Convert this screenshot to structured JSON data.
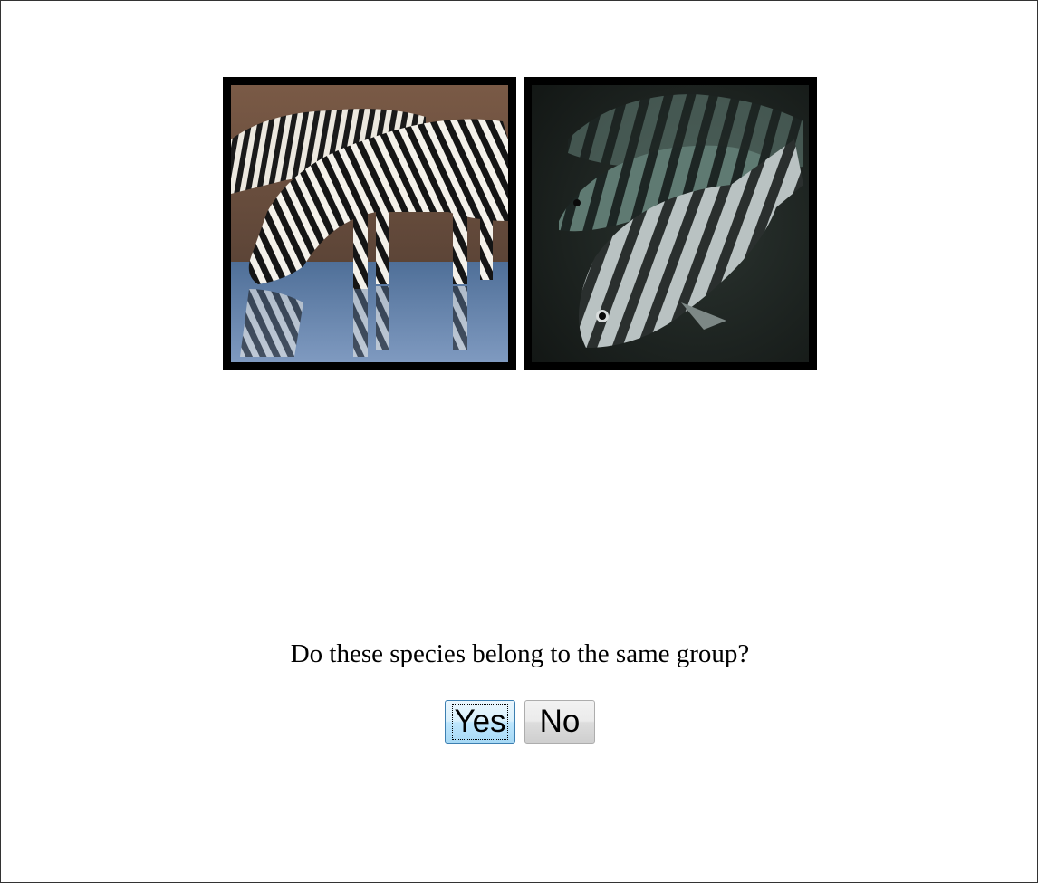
{
  "images": [
    {
      "icon": "zebra-photo",
      "subject": "zebras"
    },
    {
      "icon": "fish-photo",
      "subject": "striped fish"
    }
  ],
  "prompt": {
    "question": "Do these species belong to the same group?"
  },
  "buttons": {
    "yes_label": "Yes",
    "no_label": "No"
  },
  "colors": {
    "frame": "#000000",
    "focus_button_border": "#3c7fb1"
  }
}
